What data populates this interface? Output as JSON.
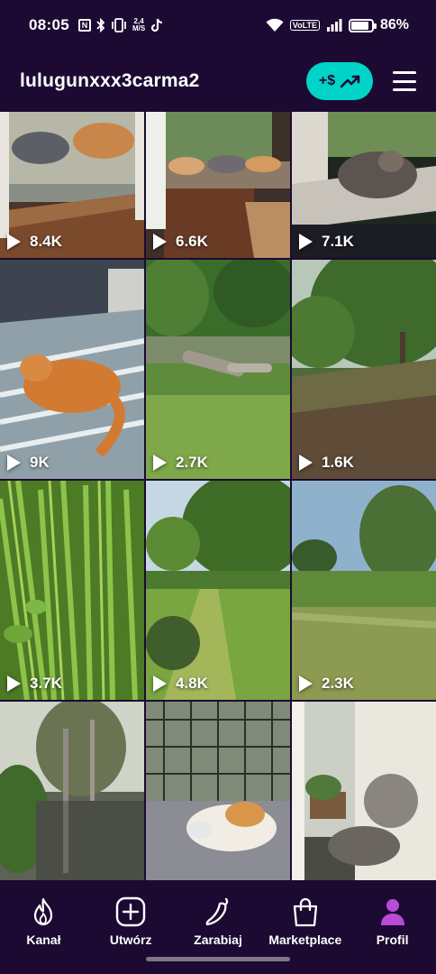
{
  "status_bar": {
    "time": "08:05",
    "net_speed_top": "2,4",
    "net_speed_bottom": "M/S",
    "volte": "VoLTE",
    "battery_percent": "86%",
    "battery_level": 0.86
  },
  "header": {
    "username": "lulugunxxx3carma2",
    "earn_button_label": "+$",
    "accent_color": "#00d4c8"
  },
  "grid": {
    "tiles": [
      {
        "views": "8.4K",
        "scene": "cats-window"
      },
      {
        "views": "6.6K",
        "scene": "cats-balcony"
      },
      {
        "views": "7.1K",
        "scene": "cat-windowsill"
      },
      {
        "views": "9K",
        "scene": "cat-bed"
      },
      {
        "views": "2.7K",
        "scene": "park-logs"
      },
      {
        "views": "1.6K",
        "scene": "meadow-tree"
      },
      {
        "views": "3.7K",
        "scene": "grass-closeup"
      },
      {
        "views": "4.8K",
        "scene": "park-path"
      },
      {
        "views": "2.3K",
        "scene": "field-tree"
      },
      {
        "views": "",
        "scene": "lake-reflection"
      },
      {
        "views": "",
        "scene": "cat-cage"
      },
      {
        "views": "",
        "scene": "cats-window-2"
      }
    ]
  },
  "bottom_nav": {
    "items": [
      {
        "label": "Kanał",
        "icon": "flame-icon"
      },
      {
        "label": "Utwórz",
        "icon": "plus-square-icon"
      },
      {
        "label": "Zarabiaj",
        "icon": "chili-icon"
      },
      {
        "label": "Marketplace",
        "icon": "shopping-bag-icon"
      },
      {
        "label": "Profil",
        "icon": "profile-icon",
        "active": true
      }
    ],
    "active_color": "#b94bd6"
  }
}
